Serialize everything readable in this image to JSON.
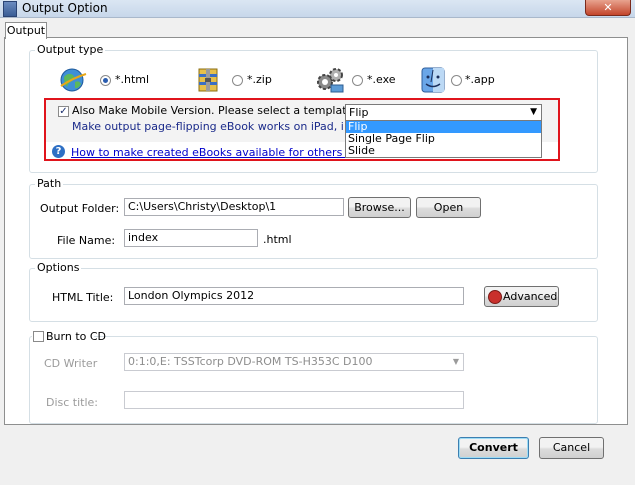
{
  "window": {
    "title": "Output Option",
    "close_glyph": "✕"
  },
  "tab": {
    "label": "Output"
  },
  "output_type": {
    "title": "Output type",
    "options": [
      {
        "label": "*.html",
        "icon": "globe-icon",
        "checked": true
      },
      {
        "label": "*.zip",
        "icon": "zip-icon",
        "checked": false
      },
      {
        "label": "*.exe",
        "icon": "gears-icon",
        "checked": false
      },
      {
        "label": "*.app",
        "icon": "mac-finder-icon",
        "checked": false
      }
    ],
    "mobile_checkbox_label": "Also Make Mobile Version. Please select a template for mobile:",
    "mobile_description": "Make output page-flipping eBook works on iPad, iPhone and Andr",
    "template_select": {
      "value": "Flip",
      "options": [
        "Flip",
        "Single Page Flip",
        "Slide"
      ]
    },
    "help_link": "How to make created eBooks available for others online?"
  },
  "path": {
    "title": "Path",
    "output_folder_label": "Output Folder:",
    "output_folder_value": "C:\\Users\\Christy\\Desktop\\1",
    "browse_label": "Browse...",
    "open_label": "Open",
    "file_name_label": "File Name:",
    "file_name_value": "index",
    "extension": ".html"
  },
  "options": {
    "title": "Options",
    "html_title_label": "HTML Title:",
    "html_title_value": "London Olympics 2012",
    "advanced_label": "Advanced"
  },
  "burn": {
    "label": "Burn to CD",
    "checked": false,
    "cd_writer_label": "CD Writer",
    "cd_writer_value": "0:1:0,E: TSSTcorp DVD-ROM TS-H353C D100",
    "disc_title_label": "Disc title:",
    "disc_title_value": ""
  },
  "footer": {
    "convert_label": "Convert",
    "cancel_label": "Cancel"
  },
  "colors": {
    "highlight_border": "#e0141c",
    "selection": "#3399ff",
    "link": "#0000cc"
  }
}
